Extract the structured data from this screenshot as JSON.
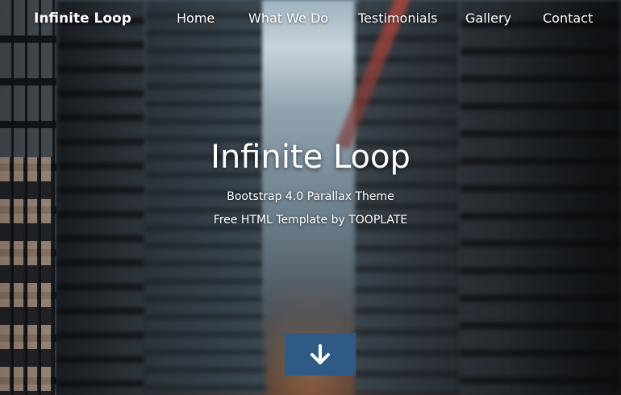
{
  "brand": "Infinite Loop",
  "nav": {
    "items": [
      {
        "label": "Home"
      },
      {
        "label": "What We Do"
      },
      {
        "label": "Testimonials"
      },
      {
        "label": "Gallery"
      },
      {
        "label": "Contact"
      }
    ]
  },
  "hero": {
    "title": "Infinite Loop",
    "subtitle_line1": "Bootstrap 4.0 Parallax Theme",
    "subtitle_line2": "Free HTML Template by TOOPLATE"
  },
  "scroll_button": {
    "icon": "arrow-down-icon",
    "color": "#2f5a86"
  }
}
